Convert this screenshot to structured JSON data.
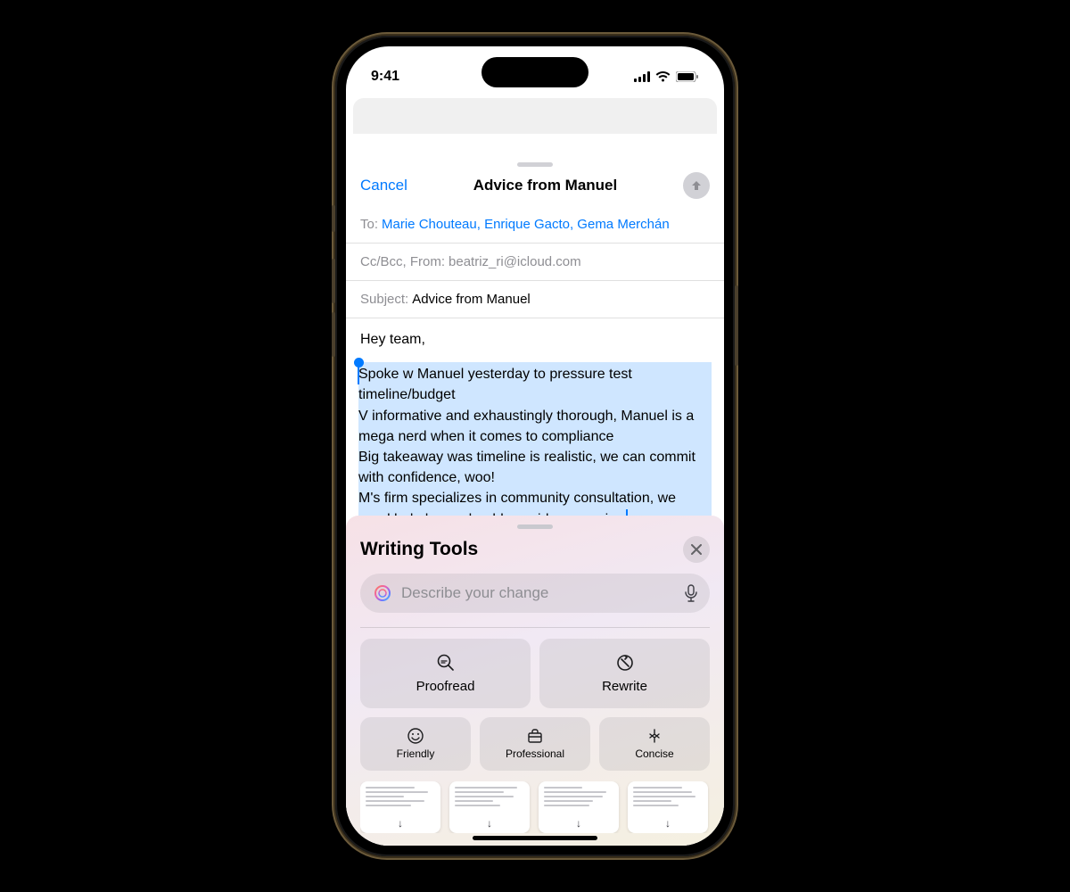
{
  "status": {
    "time": "9:41"
  },
  "compose": {
    "cancel": "Cancel",
    "title": "Advice from Manuel",
    "to_label": "To:",
    "recipients": "Marie Chouteau, Enrique Gacto, Gema Merchán",
    "cc_label": "Cc/Bcc, From:",
    "from": "beatriz_ri@icloud.com",
    "subject_label": "Subject:",
    "subject": "Advice from Manuel",
    "greeting": "Hey team,",
    "selected_text": "Spoke w Manuel yesterday to pressure test timeline/budget\nV informative and exhaustingly thorough, Manuel is a mega nerd when it comes to compliance\nBig takeaway was timeline is realistic, we can commit with confidence, woo!\nM's firm specializes in community consultation, we need help here, should consider engaging"
  },
  "tools": {
    "title": "Writing Tools",
    "placeholder": "Describe your change",
    "proofread": "Proofread",
    "rewrite": "Rewrite",
    "friendly": "Friendly",
    "professional": "Professional",
    "concise": "Concise"
  }
}
